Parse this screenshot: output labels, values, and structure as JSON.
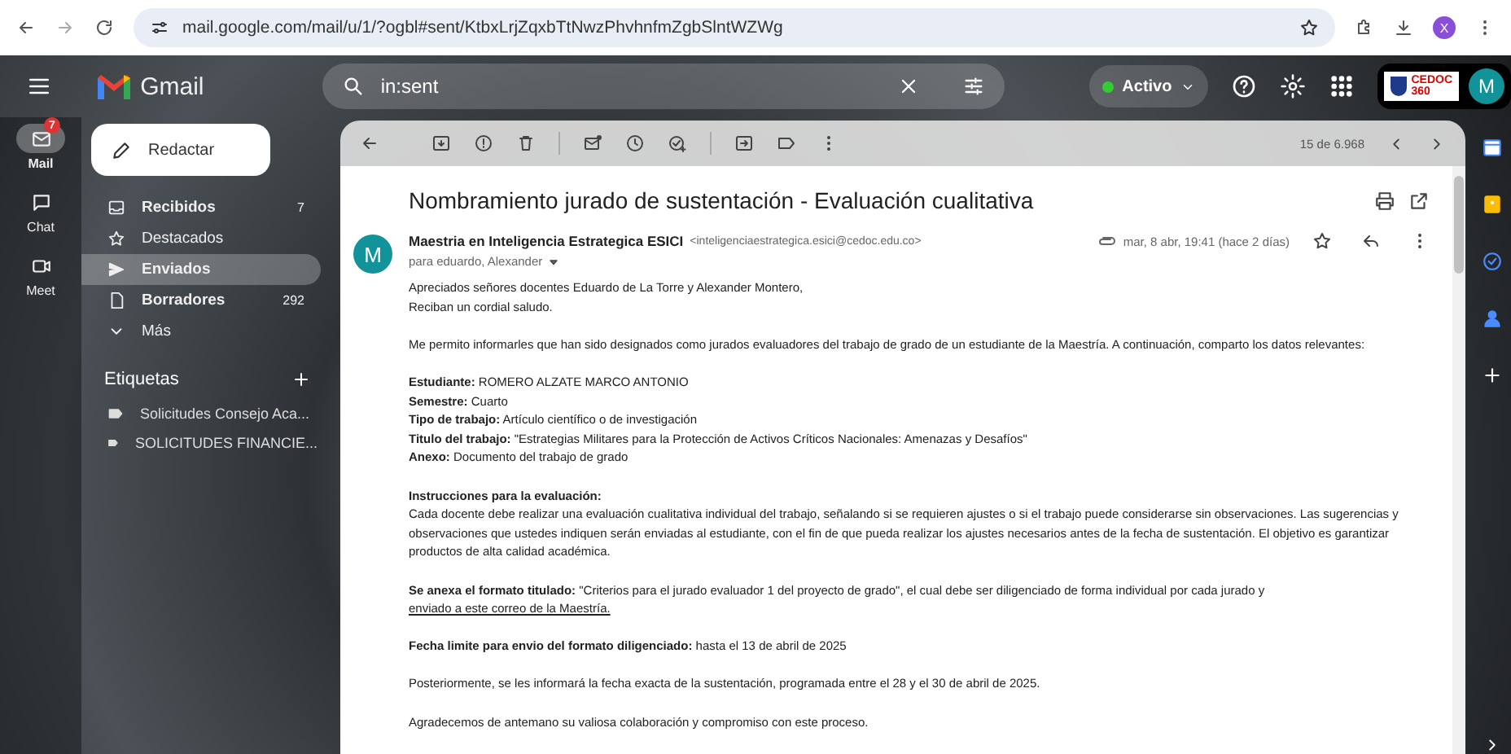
{
  "browser": {
    "url": "mail.google.com/mail/u/1/?ogbl#sent/KtbxLrjZqxbTtNwzPhvhnfmZgbSlntWZWg",
    "profile_initial": "X"
  },
  "header": {
    "app_name": "Gmail",
    "search": {
      "value": "in:sent"
    },
    "status": "Activo",
    "org_logo_text": "CEDOC",
    "org_logo_sub": "360",
    "avatar_initial": "M"
  },
  "rail": [
    {
      "label": "Mail",
      "badge": "7",
      "selected": true
    },
    {
      "label": "Chat",
      "selected": false
    },
    {
      "label": "Meet",
      "selected": false
    }
  ],
  "compose": "Redactar",
  "folders": [
    {
      "label": "Recibidos",
      "count": "7",
      "bold": true,
      "selected": false
    },
    {
      "label": "Destacados",
      "bold": false,
      "selected": false
    },
    {
      "label": "Enviados",
      "bold": true,
      "selected": true
    },
    {
      "label": "Borradores",
      "count": "292",
      "bold": true,
      "selected": false
    },
    {
      "label": "Más",
      "bold": false,
      "selected": false
    }
  ],
  "labels": {
    "title": "Etiquetas",
    "items": [
      "Solicitudes Consejo Aca...",
      "SOLICITUDES FINANCIE..."
    ]
  },
  "toolbar": {
    "pager": "15 de 6.968"
  },
  "message": {
    "subject": "Nombramiento jurado de sustentación - Evaluación cualitativa",
    "sender_initial": "M",
    "sender_name": "Maestria en Inteligencia Estrategica ESICI",
    "sender_email": "<inteligenciaestrategica.esici@cedoc.edu.co>",
    "recipients": "para eduardo, Alexander",
    "date": "mar, 8 abr, 19:41 (hace 2 días)",
    "body": [
      {
        "kind": "lines",
        "lines": [
          "Apreciados señores docentes Eduardo de La Torre y Alexander Montero,",
          "Reciban un cordial saludo."
        ]
      },
      {
        "kind": "paragraph",
        "text": "Me permito informarles que han sido designados como jurados evaluadores del trabajo de grado de un estudiante de la Maestría. A continuación, comparto los datos relevantes:"
      },
      {
        "kind": "lines",
        "lines": [
          "**Estudiante:** ROMERO ALZATE MARCO ANTONIO",
          "**Semestre:** Cuarto",
          "**Tipo de trabajo:** Artículo científico o de investigación",
          "**Titulo del trabajo:** \"Estrategias Militares para la Protección de Activos Críticos Nacionales: Amenazas y Desafíos\"",
          "**Anexo:** Documento del trabajo de grado"
        ]
      },
      {
        "kind": "section",
        "heading": "Instrucciones para la evaluación:",
        "text": "Cada docente debe realizar una evaluación cualitativa individual del trabajo, señalando si se requieren ajustes o si el trabajo puede considerarse sin observaciones. Las sugerencias y observaciones que ustedes indiquen serán enviadas al estudiante, con el fin de que pueda realizar los ajustes necesarios antes de la fecha de sustentación. El objetivo es garantizar productos de alta calidad académica."
      },
      {
        "kind": "paragraph",
        "text": "**Se anexa el formato titulado:** \"Criterios para el jurado evaluador 1 del proyecto de grado\", el cual debe ser diligenciado de forma individual por cada jurado y",
        "link": "enviado a este correo de la Maestría."
      },
      {
        "kind": "paragraph",
        "text": "**Fecha limite para envio del formato diligenciado:** hasta el 13 de abril de 2025"
      },
      {
        "kind": "paragraph",
        "text": "Posteriormente, se les informará la fecha exacta de la sustentación, programada entre el 28 y el 30 de abril de 2025."
      },
      {
        "kind": "paragraph",
        "text": "Agradecemos de antemano su valiosa colaboración y compromiso con este proceso."
      }
    ]
  }
}
